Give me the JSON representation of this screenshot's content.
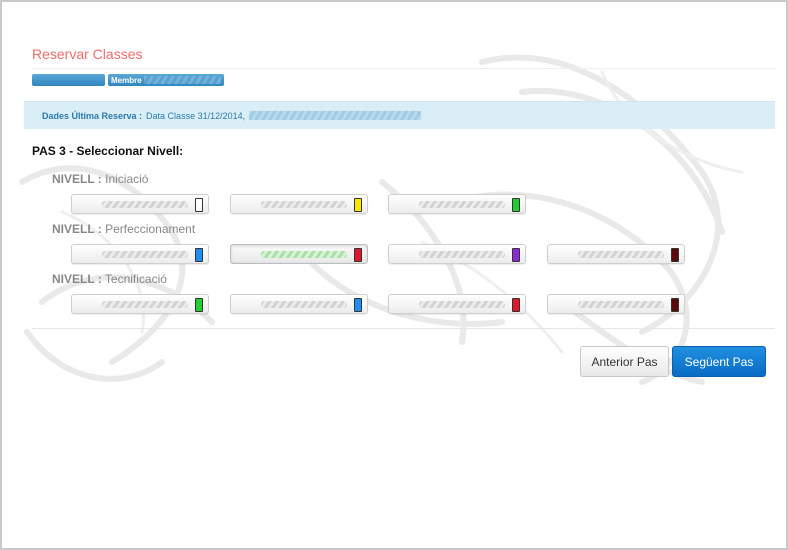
{
  "page": {
    "title": "Reservar Classes"
  },
  "breadcrumb": {
    "member_label": "Membre"
  },
  "info_bar": {
    "label": "Dades Última Reserva :",
    "value": "Data Classe 31/12/2014,"
  },
  "step": {
    "title": "PAS 3 - Seleccionar Nivell:"
  },
  "levels": [
    {
      "key": "NIVELL :",
      "name": "Iniciació",
      "options": [
        {
          "color": "#ffffff",
          "selected": false
        },
        {
          "color": "#f7e600",
          "selected": false
        },
        {
          "color": "#22cc33",
          "selected": false
        }
      ]
    },
    {
      "key": "NIVELL :",
      "name": "Perfeccionament",
      "options": [
        {
          "color": "#1e8ff0",
          "selected": false
        },
        {
          "color": "#e0162a",
          "selected": true
        },
        {
          "color": "#8a2bd4",
          "selected": false
        },
        {
          "color": "#5a0a0a",
          "selected": false
        }
      ]
    },
    {
      "key": "NIVELL :",
      "name": "Tecnificació",
      "options": [
        {
          "color": "#22cc33",
          "selected": false
        },
        {
          "color": "#1e8ff0",
          "selected": false
        },
        {
          "color": "#e0162a",
          "selected": false
        },
        {
          "color": "#5a0a0a",
          "selected": false
        }
      ]
    }
  ],
  "actions": {
    "prev_label": "Anterior Pas",
    "next_label": "Següent Pas"
  }
}
